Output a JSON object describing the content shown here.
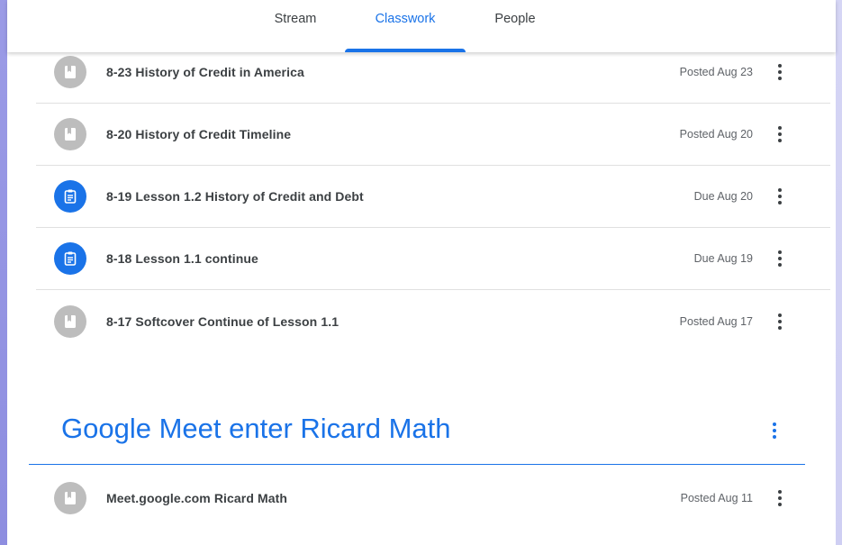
{
  "tabs": {
    "stream": "Stream",
    "classwork": "Classwork",
    "people": "People",
    "active": "classwork"
  },
  "colors": {
    "accent": "#1a73e8",
    "material_icon_bg": "#bdbdbd",
    "assignment_icon_bg": "#1a73e8"
  },
  "items": [
    {
      "title": "8-23 History of Credit in America",
      "date": "Posted Aug 23",
      "icon": "material-bookmark-icon"
    },
    {
      "title": "8-20 History of Credit Timeline",
      "date": "Posted Aug 20",
      "icon": "material-bookmark-icon"
    },
    {
      "title": "8-19 Lesson 1.2 History of Credit and Debt",
      "date": "Due Aug 20",
      "icon": "assignment-clipboard-icon"
    },
    {
      "title": "8-18 Lesson 1.1 continue",
      "date": "Due Aug 19",
      "icon": "assignment-clipboard-icon"
    },
    {
      "title": "8-17 Softcover Continue of Lesson 1.1",
      "date": "Posted Aug 17",
      "icon": "material-bookmark-icon"
    }
  ],
  "topic": {
    "title": "Google Meet enter Ricard Math",
    "items": [
      {
        "title": "Meet.google.com Ricard Math",
        "date": "Posted Aug 11",
        "icon": "material-bookmark-icon"
      }
    ]
  }
}
